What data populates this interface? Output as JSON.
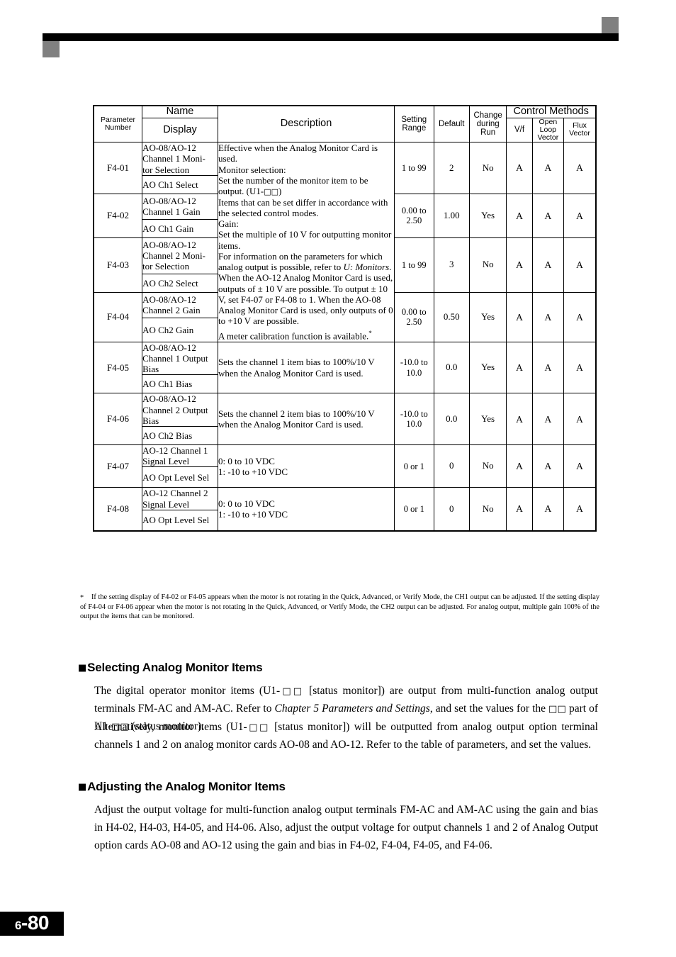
{
  "page": {
    "chapter": "6",
    "number": "80"
  },
  "table": {
    "headers": {
      "parameter_number": "Parameter\nNumber",
      "name": "Name",
      "display": "Display",
      "description": "Description",
      "setting_range": "Setting\nRange",
      "default": "Default",
      "change_during_run": "Change\nduring\nRun",
      "control_methods": "Control Methods",
      "vf": "V/f",
      "open_loop_vector": "Open\nLoop\nVector",
      "flux_vector": "Flux\nVector"
    },
    "rows": [
      {
        "parameter_number": "F4-01",
        "name": "AO-08/AO-12 Channel 1 Monitor Selection",
        "display": "AO Ch1 Select",
        "setting_range": "1 to 99",
        "default": "2",
        "change_during_run": "No",
        "vf": "A",
        "open_loop_vector": "A",
        "flux_vector": "A"
      },
      {
        "parameter_number": "F4-02",
        "name": "AO-08/AO-12 Channel 1 Gain",
        "display": "AO Ch1 Gain",
        "setting_range": "0.00 to 2.50",
        "default": "1.00",
        "change_during_run": "Yes",
        "vf": "A",
        "open_loop_vector": "A",
        "flux_vector": "A"
      },
      {
        "parameter_number": "F4-03",
        "name": "AO-08/AO-12 Channel 2 Monitor Selection",
        "display": "AO Ch2 Select",
        "setting_range": "1 to 99",
        "default": "3",
        "change_during_run": "No",
        "vf": "A",
        "open_loop_vector": "A",
        "flux_vector": "A"
      },
      {
        "parameter_number": "F4-04",
        "name": "AO-08/AO-12 Channel 2 Gain",
        "display": "AO Ch2 Gain",
        "setting_range": "0.00 to 2.50",
        "default": "0.50",
        "change_during_run": "Yes",
        "vf": "A",
        "open_loop_vector": "A",
        "flux_vector": "A"
      },
      {
        "parameter_number": "F4-05",
        "name": "AO-08/AO-12 Channel 1 Output Bias",
        "display": "AO Ch1 Bias",
        "description": "Sets the channel 1 item bias to 100%/10 V when the Analog Monitor Card is used.",
        "setting_range": "-10.0 to 10.0",
        "default": "0.0",
        "change_during_run": "Yes",
        "vf": "A",
        "open_loop_vector": "A",
        "flux_vector": "A"
      },
      {
        "parameter_number": "F4-06",
        "name": "AO-08/AO-12 Channel 2 Output Bias",
        "display": "AO Ch2 Bias",
        "description": "Sets the channel 2 item bias to 100%/10 V when the Analog Monitor Card is used.",
        "setting_range": "-10.0 to 10.0",
        "default": "0.0",
        "change_during_run": "Yes",
        "vf": "A",
        "open_loop_vector": "A",
        "flux_vector": "A"
      },
      {
        "parameter_number": "F4-07",
        "name": "AO-12 Channel 1 Signal Level",
        "display": "AO Opt Level Sel",
        "description_line1": "0:  0 to 10 VDC",
        "description_line2": "1:  -10 to +10 VDC",
        "setting_range": "0 or 1",
        "default": "0",
        "change_during_run": "No",
        "vf": "A",
        "open_loop_vector": "A",
        "flux_vector": "A"
      },
      {
        "parameter_number": "F4-08",
        "name": "AO-12 Channel 2 Signal Level",
        "display": "AO Opt Level Sel",
        "description_line1": "0:  0 to 10 VDC",
        "description_line2": "1:  -10 to +10 VDC",
        "setting_range": "0 or 1",
        "default": "0",
        "change_during_run": "No",
        "vf": "A",
        "open_loop_vector": "A",
        "flux_vector": "A"
      }
    ],
    "merged_description": {
      "l1": "Effective when the Analog Monitor Card is used.",
      "l2": "Monitor selection:",
      "l3_a": "Set the number of the monitor item to be output. (U1-",
      "l3_sq": "□□",
      "l3_b": ")",
      "l4": "Items that can be set differ in accordance with the selected control modes.",
      "l5": "Gain:",
      "l6": "Set the multiple of 10 V for outputting monitor items.",
      "l7_a": "For information on the parameters for which analog output is possible, refer to ",
      "l7_ital": "U: Monitors",
      "l7_b": ".",
      "l8": "When the AO-12 Analog Monitor Card is used, outputs of ± 10 V are possible. To output ± 10 V, set F4-07 or F4-08 to 1. When the AO-08 Analog Monitor Card is used, only outputs of 0 to +10 V are possible.",
      "l9": "A meter calibration function is available."
    }
  },
  "footnote": {
    "marker": "*",
    "text": "If the setting display of F4-02 or F4-05 appears when the motor is not rotating in the Quick, Advanced, or Verify Mode, the CH1 output can be adjusted. If the setting display of F4-04 or F4-06 appear when the motor is not rotating in the Quick, Advanced, or Verify Mode, the CH2 output can be adjusted. For analog output, multiple gain 100% of the output the items that can be monitored."
  },
  "sections": [
    {
      "heading": "Selecting Analog Monitor Items",
      "paragraph1": {
        "p1": "The digital operator monitor items (U1-",
        "sq1": "□□",
        "p2": " [status monitor]) are output from multi-function analog output terminals FM-AC and AM-AC. Refer to ",
        "ital": "Chapter 5 Parameters and Settings",
        "p3": ", and set the values for the ",
        "sq2": "□□",
        "p4": " part of U1-",
        "sq3": "□□",
        "p5": " (status monitor)."
      },
      "paragraph2": {
        "p1": "Alternatively, monitor items (U1-",
        "sq1": "□□",
        "p2": " [status monitor]) will be outputted from analog output option terminal channels 1 and 2 on analog monitor cards AO-08 and AO-12. Refer to the table of parameters, and set the values."
      }
    },
    {
      "heading": "Adjusting the Analog Monitor Items",
      "paragraph1": {
        "text": "Adjust the output voltage for multi-function analog output terminals FM-AC and AM-AC using the gain and bias in H4-02, H4-03, H4-05, and H4-06. Also, adjust the output voltage for output channels 1 and 2 of Analog Output option cards AO-08 and AO-12 using the gain and bias in F4-02, F4-04, F4-05, and F4-06."
      }
    }
  ]
}
